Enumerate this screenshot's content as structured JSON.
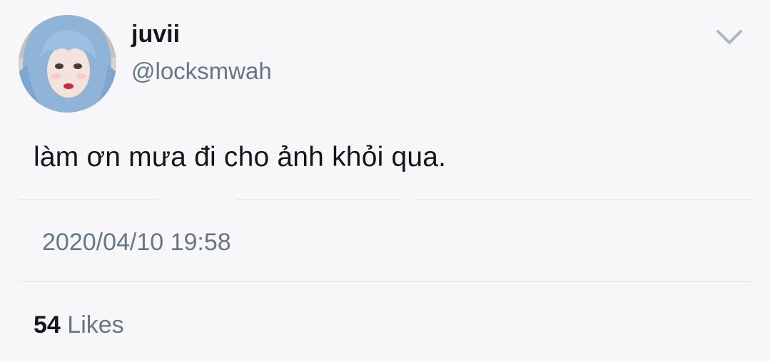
{
  "tweet": {
    "display_name": "juvii",
    "handle": "@locksmwah",
    "text": "làm ơn mưa đi cho ảnh khỏi qua.",
    "timestamp": "2020/04/10 19:58",
    "likes_count": "54",
    "likes_label": "Likes"
  },
  "icons": {
    "menu": "chevron-down-icon",
    "avatar": "avatar-photo"
  },
  "colors": {
    "background": "#f7f7f9",
    "primary_text": "#14171a",
    "secondary_text": "#657786",
    "divider": "#dfe1e5",
    "avatar_hair": "#8fb4d8"
  }
}
